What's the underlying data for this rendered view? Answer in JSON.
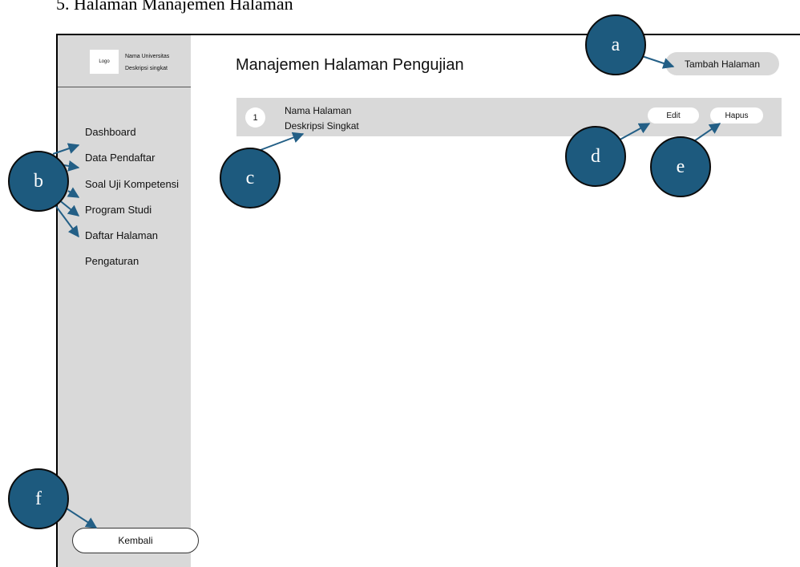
{
  "document": {
    "heading": "5.   Halaman Manajemen Halaman"
  },
  "sidebar": {
    "logo": "Logo",
    "brand_name": "Nama Universitas",
    "brand_description": "Deskripsi singkat",
    "items": [
      {
        "label": "Dashboard"
      },
      {
        "label": "Data Pendaftar"
      },
      {
        "label": "Soal Uji Kompetensi"
      },
      {
        "label": "Program Studi"
      },
      {
        "label": "Daftar Halaman"
      },
      {
        "label": "Pengaturan"
      }
    ],
    "back_label": "Kembali"
  },
  "main": {
    "title": "Manajemen Halaman Pengujian",
    "add_label": "Tambah Halaman",
    "rows": [
      {
        "number": "1",
        "name": "Nama Halaman",
        "description": "Deskripsi Singkat",
        "edit_label": "Edit",
        "delete_label": "Hapus"
      }
    ]
  },
  "annotations": {
    "a": "a",
    "b": "b",
    "c": "c",
    "d": "d",
    "e": "e",
    "f": "f"
  },
  "colors": {
    "marker_fill": "#1d5a7e",
    "arrow": "#235f86",
    "panel": "#d9d9d9"
  }
}
